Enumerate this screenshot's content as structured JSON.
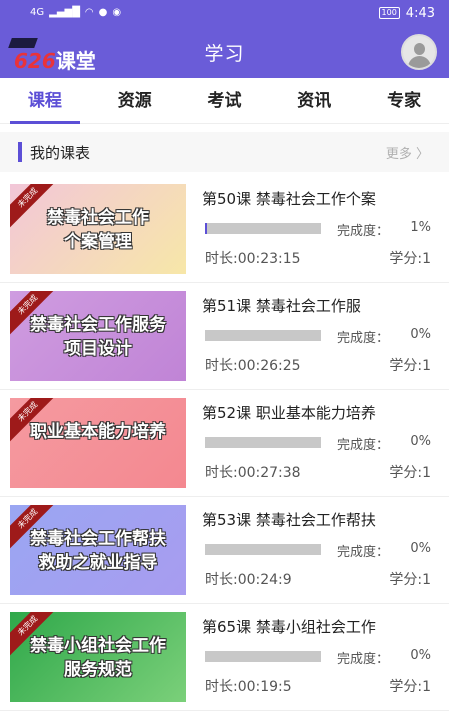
{
  "status_bar": {
    "network": "4G",
    "battery": "100",
    "time": "4:43"
  },
  "header": {
    "logo_number": "626",
    "logo_text": "课堂",
    "title": "学习"
  },
  "tabs": [
    {
      "label": "课程",
      "active": true
    },
    {
      "label": "资源",
      "active": false
    },
    {
      "label": "考试",
      "active": false
    },
    {
      "label": "资讯",
      "active": false
    },
    {
      "label": "专家",
      "active": false
    }
  ],
  "section": {
    "title": "我的课表",
    "more": "更多 〉"
  },
  "progress_label": "完成度：",
  "courses": [
    {
      "title": "第50课 禁毒社会工作个案",
      "thumb_line1": "禁毒社会工作",
      "thumb_line2": "个案管理",
      "badge": "未完成",
      "progress": "1%",
      "progress_fraction": 0.01,
      "duration": "时长:00:23:15",
      "credit": "学分:1",
      "thumb_bg": "#f2c6d8",
      "thumb_bg2": "#f7e7a8"
    },
    {
      "title": "第51课 禁毒社会工作服",
      "thumb_line1": "禁毒社会工作服务",
      "thumb_line2": "项目设计",
      "badge": "未完成",
      "progress": "0%",
      "progress_fraction": 0.0,
      "duration": "时长:00:26:25",
      "credit": "学分:1",
      "thumb_bg": "#cf9ce0",
      "thumb_bg2": "#c084d6"
    },
    {
      "title": "第52课 职业基本能力培养",
      "thumb_line1": "职业基本能力培养",
      "thumb_line2": "",
      "badge": "未完成",
      "progress": "0%",
      "progress_fraction": 0.0,
      "duration": "时长:00:27:38",
      "credit": "学分:1",
      "thumb_bg": "#f59aa0",
      "thumb_bg2": "#f48890"
    },
    {
      "title": "第53课 禁毒社会工作帮扶",
      "thumb_line1": "禁毒社会工作帮扶",
      "thumb_line2": "救助之就业指导",
      "badge": "未完成",
      "progress": "0%",
      "progress_fraction": 0.0,
      "duration": "时长:00:24:9",
      "credit": "学分:1",
      "thumb_bg": "#9aa6f2",
      "thumb_bg2": "#a89cf0"
    },
    {
      "title": "第65课 禁毒小组社会工作",
      "thumb_line1": "禁毒小组社会工作",
      "thumb_line2": "服务规范",
      "badge": "未完成",
      "progress": "0%",
      "progress_fraction": 0.0,
      "duration": "时长:00:19:5",
      "credit": "学分:1",
      "thumb_bg": "#2fa84a",
      "thumb_bg2": "#7bd07a"
    }
  ],
  "colors": {
    "primary": "#6a5cd8",
    "accent": "#5c4fd6",
    "badge": "#9e1a1a"
  }
}
